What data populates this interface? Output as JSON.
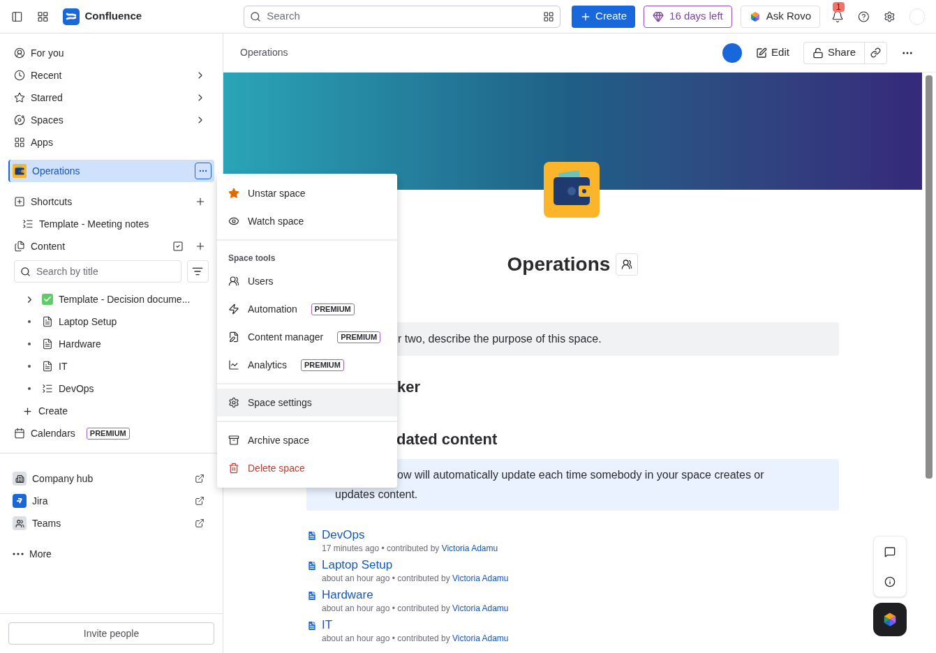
{
  "topbar": {
    "product": "Confluence",
    "search": {
      "placeholder": "Search"
    },
    "create": "Create",
    "trial": "16 days left",
    "rovo": "Ask Rovo",
    "notification_count": "1"
  },
  "sidebar": {
    "nav": [
      {
        "label": "For you",
        "chevron": false
      },
      {
        "label": "Recent",
        "chevron": true
      },
      {
        "label": "Starred",
        "chevron": true
      },
      {
        "label": "Spaces",
        "chevron": true
      },
      {
        "label": "Apps",
        "chevron": false
      }
    ],
    "space": {
      "name": "Operations",
      "selected": true
    },
    "shortcuts": {
      "label": "Shortcuts",
      "items": [
        "Template - Meeting notes"
      ]
    },
    "content": {
      "label": "Content",
      "search": {
        "placeholder": "Search by title"
      },
      "tree": [
        {
          "label": "Template - Decision docume...",
          "kind": "decision",
          "expandable": true
        },
        {
          "label": "Laptop Setup",
          "kind": "page",
          "expandable": false
        },
        {
          "label": "Hardware",
          "kind": "page",
          "expandable": false
        },
        {
          "label": "IT",
          "kind": "page",
          "expandable": false
        },
        {
          "label": "DevOps",
          "kind": "live",
          "expandable": false
        }
      ],
      "create": "Create"
    },
    "calendars": {
      "label": "Calendars",
      "badge": "PREMIUM"
    },
    "apps": [
      {
        "label": "Company hub",
        "kind": "hub"
      },
      {
        "label": "Jira",
        "kind": "jira"
      },
      {
        "label": "Teams",
        "kind": "teams"
      }
    ],
    "more": "More",
    "invite": "Invite people"
  },
  "header": {
    "breadcrumb": "Operations",
    "edit": "Edit",
    "share": "Share"
  },
  "page": {
    "title": "Operations",
    "description": "r two, describe the purpose of this space.",
    "heading_1": "ker",
    "heading_2": "dated content",
    "info": [
      "ow will automatically update each time somebody in your space creates or",
      "updates content."
    ],
    "recent": [
      {
        "title": "DevOps",
        "meta": "17 minutes ago • contributed by",
        "author": "Victoria Adamu"
      },
      {
        "title": "Laptop Setup",
        "meta": "about an hour ago • contributed by",
        "author": "Victoria Adamu"
      },
      {
        "title": "Hardware",
        "meta": "about an hour ago • contributed by",
        "author": "Victoria Adamu"
      },
      {
        "title": "IT",
        "meta": "about an hour ago • contributed by",
        "author": "Victoria Adamu"
      }
    ]
  },
  "menu": {
    "groups": [
      {
        "items": [
          {
            "label": "Unstar space",
            "selected": false,
            "danger": false
          },
          {
            "label": "Watch space",
            "selected": false,
            "danger": false
          }
        ]
      },
      {
        "header": "Space tools",
        "items": [
          {
            "label": "Users",
            "selected": false,
            "danger": false
          },
          {
            "label": "Automation",
            "badge": "PREMIUM",
            "selected": false,
            "danger": false
          },
          {
            "label": "Content manager",
            "badge": "PREMIUM",
            "selected": false,
            "danger": false
          },
          {
            "label": "Analytics",
            "badge": "PREMIUM",
            "selected": false,
            "danger": false
          }
        ]
      },
      {
        "items": [
          {
            "label": "Space settings",
            "selected": true,
            "danger": false
          }
        ]
      },
      {
        "items": [
          {
            "label": "Archive space",
            "selected": false,
            "danger": false
          },
          {
            "label": "Delete space",
            "selected": false,
            "danger": true
          }
        ]
      }
    ]
  }
}
